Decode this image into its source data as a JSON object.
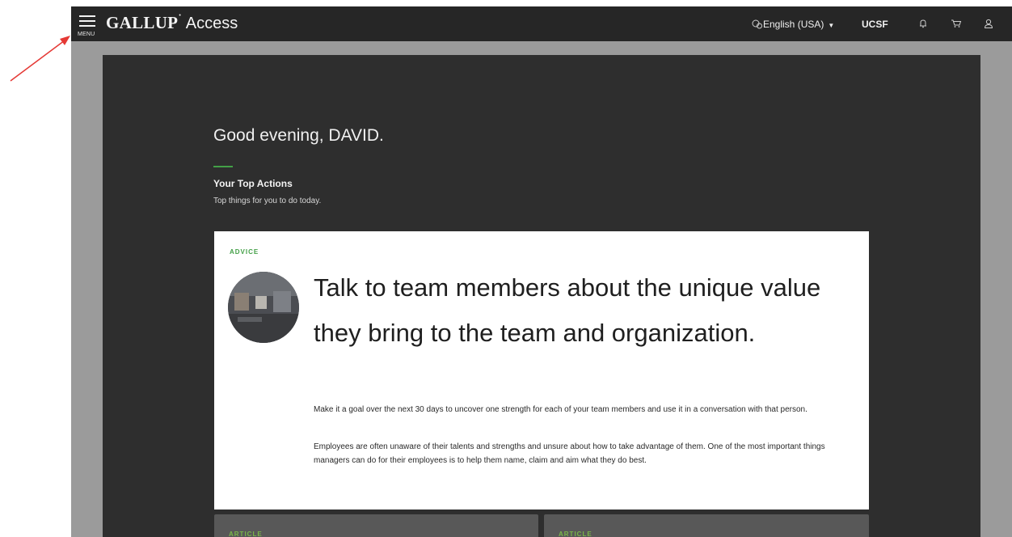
{
  "header": {
    "menu_label": "MENU",
    "brand": "GALLUP",
    "brand_product": "Access",
    "language": "English (USA)",
    "organization": "UCSF",
    "icons": [
      "menu-icon",
      "globe-icon",
      "bell-icon",
      "cart-icon",
      "user-icon"
    ]
  },
  "main": {
    "greeting": "Good evening, DAVID.",
    "section_title": "Your Top Actions",
    "section_subtitle": "Top things for you to do today."
  },
  "advice_card": {
    "tag": "ADVICE",
    "title": "Talk to team members about the unique value they bring to the team and organization.",
    "paragraph1": "Make it a goal over the next 30 days to uncover one strength for each of your team members and use it in a conversation with that person.",
    "paragraph2": "Employees are often unaware of their talents and strengths and unsure about how to take advantage of them. One of the most important things managers can do for their employees is to help them name, claim and aim what they do best."
  },
  "more_cards": [
    {
      "tag": "ARTICLE"
    },
    {
      "tag": "ARTICLE"
    }
  ],
  "colors": {
    "topbar": "#262626",
    "panel": "#2e2e2e",
    "frame": "#9b9b9b",
    "accent_green": "#43a047",
    "annotation_arrow": "#e53935"
  }
}
